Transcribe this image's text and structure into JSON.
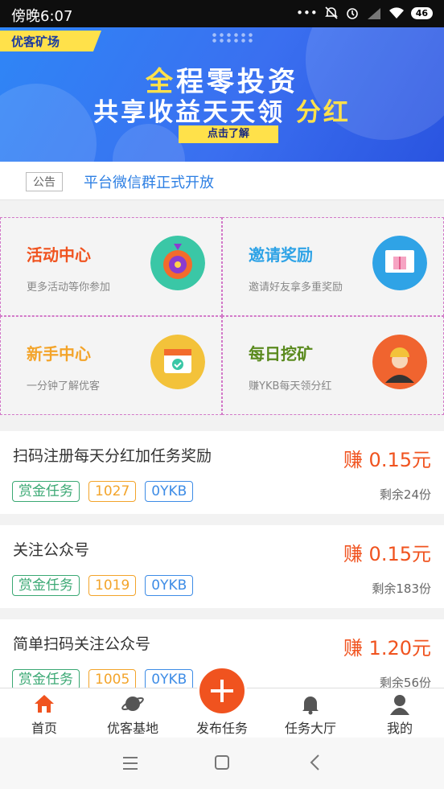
{
  "status_bar": {
    "time": "傍晚6:07",
    "battery": "46",
    "icons": [
      "dots-icon",
      "mute-icon",
      "alarm-icon",
      "signal-icon",
      "wifi-icon",
      "battery-icon"
    ]
  },
  "banner": {
    "tag": "优客矿场",
    "line1_highlight": "全",
    "line1_rest": "程零投资",
    "line2_main": "共享收益天天领",
    "line2_highlight": "分红",
    "cta": "点击了解",
    "colors": {
      "background": "#3a6ff0",
      "accent": "#ffe14a"
    }
  },
  "notice": {
    "tag": "公告",
    "message": "平台微信群正式开放"
  },
  "features": [
    {
      "title": "活动中心",
      "subtitle": "更多活动等你参加",
      "color": "#f0531f",
      "icon": "wheel-icon"
    },
    {
      "title": "邀请奖励",
      "subtitle": "邀请好友拿多重奖励",
      "color": "#2fa3e6",
      "icon": "gift-icon"
    },
    {
      "title": "新手中心",
      "subtitle": "一分钟了解优客",
      "color": "#f3a42a",
      "icon": "calendar-check-icon"
    },
    {
      "title": "每日挖矿",
      "subtitle": "赚YKB每天领分红",
      "color": "#5a8a1e",
      "icon": "miner-icon"
    }
  ],
  "tasks": [
    {
      "name": "扫码注册每天分红加任务奖励",
      "earn": "赚 0.15元",
      "tags": [
        "赏金任务",
        "1027",
        "0YKB"
      ],
      "remaining": "剩余24份"
    },
    {
      "name": "关注公众号",
      "earn": "赚 0.15元",
      "tags": [
        "赏金任务",
        "1019",
        "0YKB"
      ],
      "remaining": "剩余183份"
    },
    {
      "name": "简单扫码关注公众号",
      "earn": "赚 1.20元",
      "tags": [
        "赏金任务",
        "1005",
        "0YKB"
      ],
      "remaining": "剩余56份"
    }
  ],
  "tabbar": {
    "items": [
      {
        "label": "首页",
        "icon": "home-icon",
        "active": true
      },
      {
        "label": "优客基地",
        "icon": "planet-icon"
      },
      {
        "label": "发布任务",
        "icon": "plus-icon"
      },
      {
        "label": "任务大厅",
        "icon": "bell-icon"
      },
      {
        "label": "我的",
        "icon": "user-icon"
      }
    ],
    "colors": {
      "active": "#f0531f",
      "inactive": "#555555"
    }
  },
  "system_nav": {
    "icons": [
      "menu-icon",
      "home-square-icon",
      "back-icon"
    ]
  }
}
